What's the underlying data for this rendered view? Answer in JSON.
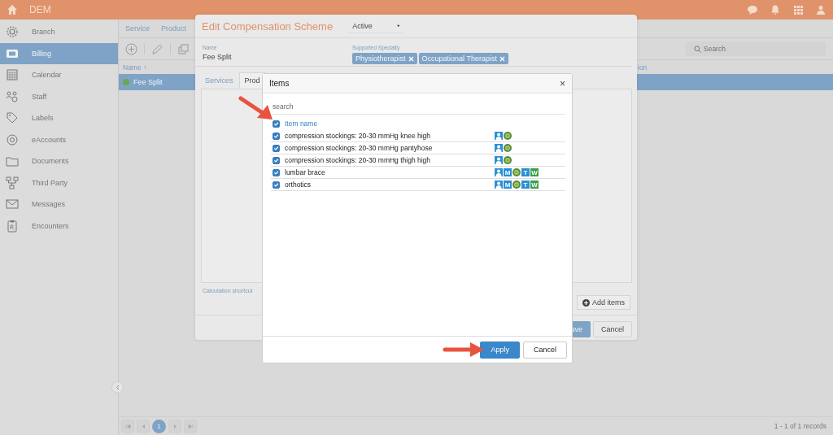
{
  "top_bar": {
    "title": "DEM"
  },
  "sidebar": {
    "items": [
      {
        "label": "Branch",
        "selected": false
      },
      {
        "label": "Billing",
        "selected": true
      },
      {
        "label": "Calendar",
        "selected": false
      },
      {
        "label": "Staff",
        "selected": false
      },
      {
        "label": "Labels",
        "selected": false
      },
      {
        "label": "eAccounts",
        "selected": false
      },
      {
        "label": "Documents",
        "selected": false
      },
      {
        "label": "Third Party",
        "selected": false
      },
      {
        "label": "Messages",
        "selected": false
      },
      {
        "label": "Encounters",
        "selected": false
      }
    ]
  },
  "list_panel": {
    "tabs": [
      "Service",
      "Product"
    ],
    "search": {
      "placeholder": "Search"
    },
    "columns": [
      {
        "label": "Name",
        "sort": "↑"
      },
      {
        "label": "ion"
      }
    ],
    "rows": [
      {
        "name": "Fee Split",
        "selected": true,
        "color": "#6aa84f"
      }
    ],
    "pager": {
      "pages": [
        {
          "label": "1",
          "selected": true
        }
      ],
      "summary": "1 - 1 of 1 records"
    }
  },
  "edit_dialog": {
    "title": "Edit Compensation Scheme",
    "status": "Active",
    "name_field": {
      "label": "Name",
      "value": "Fee Split"
    },
    "specialty_field": {
      "label": "Supported Specialty",
      "tags": [
        "Physiotherapist",
        "Occupational Therapist"
      ]
    },
    "tabs": [
      {
        "label": "Services",
        "selected": false
      },
      {
        "label": "Prod",
        "selected": true
      }
    ],
    "calculation_shortcut": "Calculation shortcut",
    "add_items": "Add items",
    "buttons": [
      "ave",
      "Cancel"
    ]
  },
  "items_dialog": {
    "title": "Items",
    "close": "×",
    "search": {
      "placeholder": "search"
    },
    "header": {
      "label": "Item name",
      "checked": true
    },
    "items": [
      {
        "name": "compression stockings: 20-30 mmHg knee high",
        "checked": true,
        "badges": [
          {
            "kind": "person"
          },
          {
            "kind": "circle"
          }
        ]
      },
      {
        "name": "compression stockings: 20-30 mmHg pantyhose",
        "checked": true,
        "badges": [
          {
            "kind": "person"
          },
          {
            "kind": "circle"
          }
        ]
      },
      {
        "name": "compression stockings: 20-30 mmHg thigh high",
        "checked": true,
        "badges": [
          {
            "kind": "person"
          },
          {
            "kind": "circle"
          }
        ]
      },
      {
        "name": "lumbar brace",
        "checked": true,
        "badges": [
          {
            "kind": "person"
          },
          {
            "kind": "letter",
            "label": "M",
            "color": "#2a8fd6"
          },
          {
            "kind": "circle"
          },
          {
            "kind": "letter",
            "label": "T",
            "color": "#2a8fd6"
          },
          {
            "kind": "letter",
            "label": "W",
            "color": "#3aa04a"
          }
        ]
      },
      {
        "name": "orthotics",
        "checked": true,
        "badges": [
          {
            "kind": "person"
          },
          {
            "kind": "letter",
            "label": "M",
            "color": "#2a8fd6"
          },
          {
            "kind": "circle"
          },
          {
            "kind": "letter",
            "label": "T",
            "color": "#2a8fd6"
          },
          {
            "kind": "letter",
            "label": "W",
            "color": "#3aa04a"
          }
        ]
      }
    ],
    "buttons": [
      {
        "label": "Apply",
        "kind": "primary"
      },
      {
        "label": "Cancel",
        "kind": "default"
      }
    ]
  }
}
